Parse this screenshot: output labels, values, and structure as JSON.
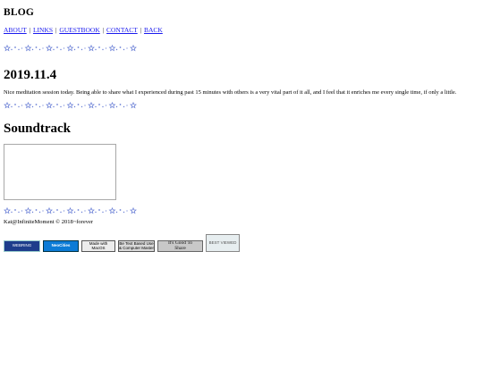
{
  "header": {
    "title": "BLOG"
  },
  "nav": {
    "items": [
      "ABOUT",
      "LINKS",
      "GUESTBOOK",
      "CONTACT",
      "BACK"
    ],
    "separator": "|"
  },
  "post": {
    "date": "2019.11.4",
    "body": "Nice meditation session today. Being able to share what I experienced during past 15 minutes with others is a very vital part of it all, and I feel that it enriches me every single time, if only a little."
  },
  "soundtrack": {
    "title": "Soundtrack"
  },
  "footer": {
    "copyright": "Kat@InfiniteMoment © 2018~forever"
  },
  "buttons": [
    {
      "name": "webring-button",
      "text": "WEBRING"
    },
    {
      "name": "neocities-button",
      "text": "NeoCities"
    },
    {
      "name": "made-with-macos-button",
      "text": "Made with\nMacOS"
    },
    {
      "name": "text-editor-button",
      "text": "Be Text Based Use\n& Computer Master"
    },
    {
      "name": "its-good-to-share-button",
      "text": "It's Good To\nShare"
    },
    {
      "name": "cd-badge-button",
      "text": "BEST VIEWED"
    }
  ],
  "colors": {
    "link": "#1a1aee",
    "divider_star": "#6a7fd6"
  }
}
